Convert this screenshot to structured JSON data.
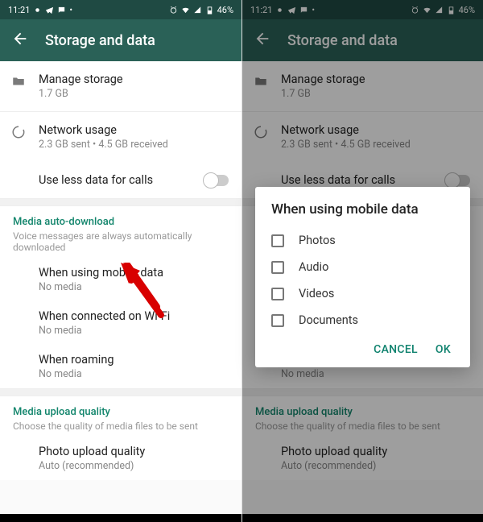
{
  "status": {
    "time": "11:21",
    "battery": "46%"
  },
  "actionbar": {
    "title": "Storage and data"
  },
  "rows": {
    "manage_title": "Manage storage",
    "manage_sub": "1.7 GB",
    "network_title": "Network usage",
    "network_sub": "2.3 GB sent • 4.5 GB received",
    "less_data_title": "Use less data for calls"
  },
  "media_section": {
    "head": "Media auto-download",
    "sub": "Voice messages are always automatically downloaded",
    "mobile_title": "When using mobile data",
    "mobile_sub": "No media",
    "wifi_title": "When connected on Wi-Fi",
    "wifi_sub": "No media",
    "roam_title": "When roaming",
    "roam_sub": "No media"
  },
  "upload_section": {
    "head": "Media upload quality",
    "sub": "Choose the quality of media files to be sent",
    "photo_title": "Photo upload quality",
    "photo_sub": "Auto (recommended)"
  },
  "dialog": {
    "title": "When using mobile data",
    "opts": [
      "Photos",
      "Audio",
      "Videos",
      "Documents"
    ],
    "cancel": "CANCEL",
    "ok": "OK"
  }
}
